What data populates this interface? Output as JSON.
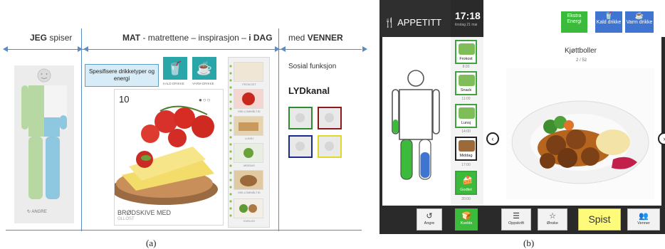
{
  "panel_a": {
    "headers": {
      "jeg_bold": "JEG",
      "jeg_rest": "spiser",
      "mat_bold": "MAT",
      "mat_rest": "- matrettene – inspirasjon –",
      "mat_dag": "i DAG",
      "med": "med",
      "venner": "VENNER"
    },
    "undo_label": "ANGRE",
    "specify_label": "Spesifisere drikketyper og energi",
    "cold_drink_label": "KALD DRIKKE",
    "warm_drink_label": "VARM DRIKKE",
    "food_number": "10",
    "food_title": "BRØDSKIVE MED",
    "food_subtitle": "OLLOST",
    "meals": [
      "FROKOST",
      "MELLOMMÅLTID",
      "LUNSJ",
      "MIDDAG",
      "MELLOMMÅLTID",
      "KVELDS"
    ],
    "social_function": "Sosial funksjon",
    "sound_channel": "LYDkanal",
    "caption": "(a)"
  },
  "panel_b": {
    "app_title": "APPETITT",
    "time": "17:18",
    "date": "tirsdag 21 mai",
    "extra_energy": "Ekstra Energi",
    "cold_drink": "Kald drikke",
    "warm_drink": "Varm drikke",
    "dish_name": "Kjøttboller",
    "dish_index": "2 / 52",
    "meals": [
      {
        "label": "Frokost"
      },
      {
        "label": "Snack"
      },
      {
        "label": "Lunsj"
      },
      {
        "label": "Middag"
      },
      {
        "label": "Godtet"
      },
      {
        "label": "Kvelds"
      }
    ],
    "times": [
      "8:00",
      "11:00",
      "14:00",
      "17:00",
      "20:00"
    ],
    "undo": "Angre",
    "recipe": "Oppskrift",
    "wish": "Ønske",
    "eaten": "Spist",
    "friends": "Venner",
    "caption": "(b)",
    "colors": {
      "green": "#3cba3c",
      "blue": "#3f75d1",
      "yellow": "#fffb7a",
      "dark": "#2a2a2a"
    }
  }
}
